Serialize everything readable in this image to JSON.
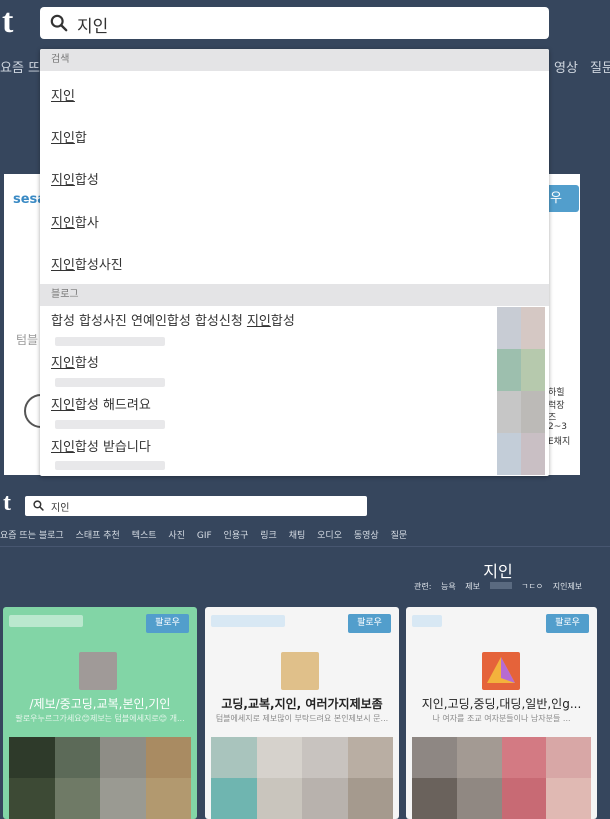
{
  "app": {
    "logo": "t"
  },
  "search": {
    "query": "지인",
    "icon": "search-icon"
  },
  "nav_top": {
    "left": "요즘 뜨",
    "right1": "영상",
    "right2": "질문"
  },
  "background_card": {
    "name": "sesa",
    "follow": "우",
    "side_label": "텀블"
  },
  "side_text": [
    "하힐",
    "럭장",
    "즈",
    "2~3",
    "E채지"
  ],
  "dropdown": {
    "search_header": "검색",
    "suggestions": [
      {
        "match": "지인",
        "rest": ""
      },
      {
        "match": "지인",
        "rest": "합"
      },
      {
        "match": "지인",
        "rest": "합성"
      },
      {
        "match": "지인",
        "rest": "합사"
      },
      {
        "match": "지인",
        "rest": "합성사진"
      }
    ],
    "blog_header": "블로그",
    "blogs": [
      {
        "pre": "합성 합성사진 연예인합성 합성신청 ",
        "match": "지인",
        "rest": "합성"
      },
      {
        "pre": "",
        "match": "지인",
        "rest": "합성"
      },
      {
        "pre": "",
        "match": "지인",
        "rest": "합성 해드려요"
      },
      {
        "pre": "",
        "match": "지인",
        "rest": "합성 받습니다"
      }
    ]
  },
  "bottom": {
    "logo": "t",
    "search_value": "지인",
    "nav": [
      "요즘 뜨는 블로그",
      "스태프 추천",
      "텍스트",
      "사진",
      "GIF",
      "인용구",
      "링크",
      "채팅",
      "오디오",
      "동영상",
      "질문"
    ],
    "title": "지인",
    "related_label": "관련:",
    "related": [
      "능욕",
      "제보",
      "ㄱㄷㅇ",
      "지인제보"
    ],
    "cards": [
      {
        "title": "/제보/중고딩,교복,본인,기인",
        "desc": "팔로우누르그가세요😊제보는 텀블에세지로😊 개...",
        "follow": "팔로우",
        "bg": "#82d5a6"
      },
      {
        "title": "고딩,교복,지인, 여러가지제보좀",
        "desc": "텀블에세지로 제보많이 부탁드려요 본인제보시 문...",
        "follow": "팔로우",
        "bg": "#f5f5f5"
      },
      {
        "title": "지인,고딩,중딩,대딩,일반,인g...",
        "desc": "나 여자를 조교 여자분들이나 남자분들 ...",
        "follow": "팔로우",
        "bg": "#f5f5f5"
      }
    ]
  },
  "colors": {
    "bg": "#36465d",
    "accent": "#529ecc",
    "green_card": "#82d5a6"
  }
}
